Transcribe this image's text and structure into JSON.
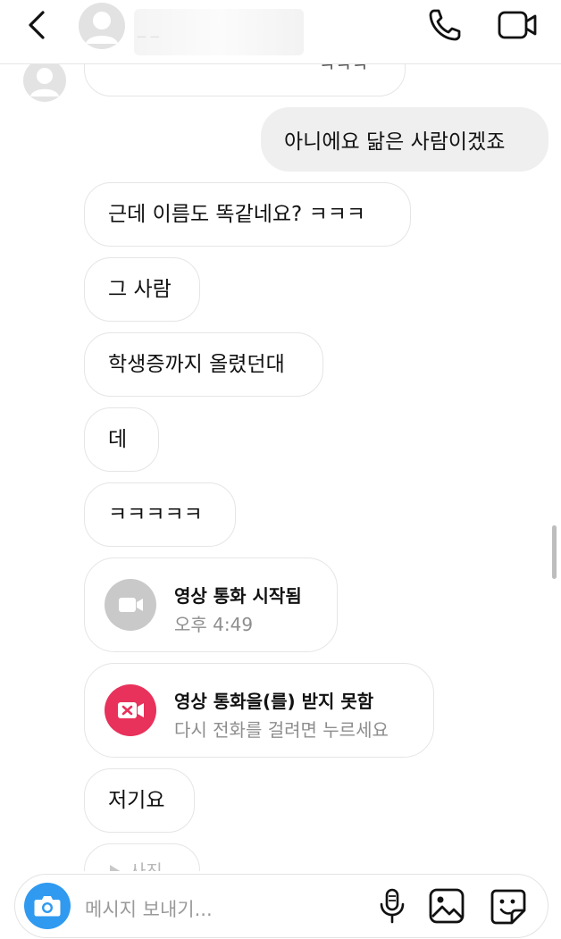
{
  "header": {
    "contact_name": "_ _",
    "icons": {
      "back": "chevron-left-icon",
      "call": "phone-icon",
      "video": "video-camera-icon"
    }
  },
  "messages": {
    "clipped_top": "ㅋㅋㅋ",
    "outgoing_1": "아니에요 닮은 사람이겠죠",
    "incoming_1": "근데 이름도 똑같네요? ㅋㅋㅋ",
    "incoming_2": "그 사람",
    "incoming_3": "학생증까지 올렸던대",
    "incoming_4": "데",
    "incoming_5": "ㅋㅋㅋㅋㅋ",
    "incoming_6": "저기요",
    "clipped_bottom": "사진"
  },
  "calls": {
    "started": {
      "title": "영상 통화 시작됨",
      "subtitle": "오후 4:49"
    },
    "missed": {
      "title": "영상 통화을(를) 받지 못함",
      "subtitle": "다시 전화를 걸려면 누르세요"
    }
  },
  "composer": {
    "placeholder": "메시지 보내기...",
    "icons": {
      "camera": "camera-icon",
      "mic": "microphone-icon",
      "gallery": "image-icon",
      "sticker": "sticker-icon"
    }
  },
  "colors": {
    "camera_button": "#2f9af0",
    "missed_call": "#e8315b",
    "started_call": "#c9c9c9",
    "outgoing_bubble": "#efefef",
    "bubble_border": "#e5e5e5"
  }
}
